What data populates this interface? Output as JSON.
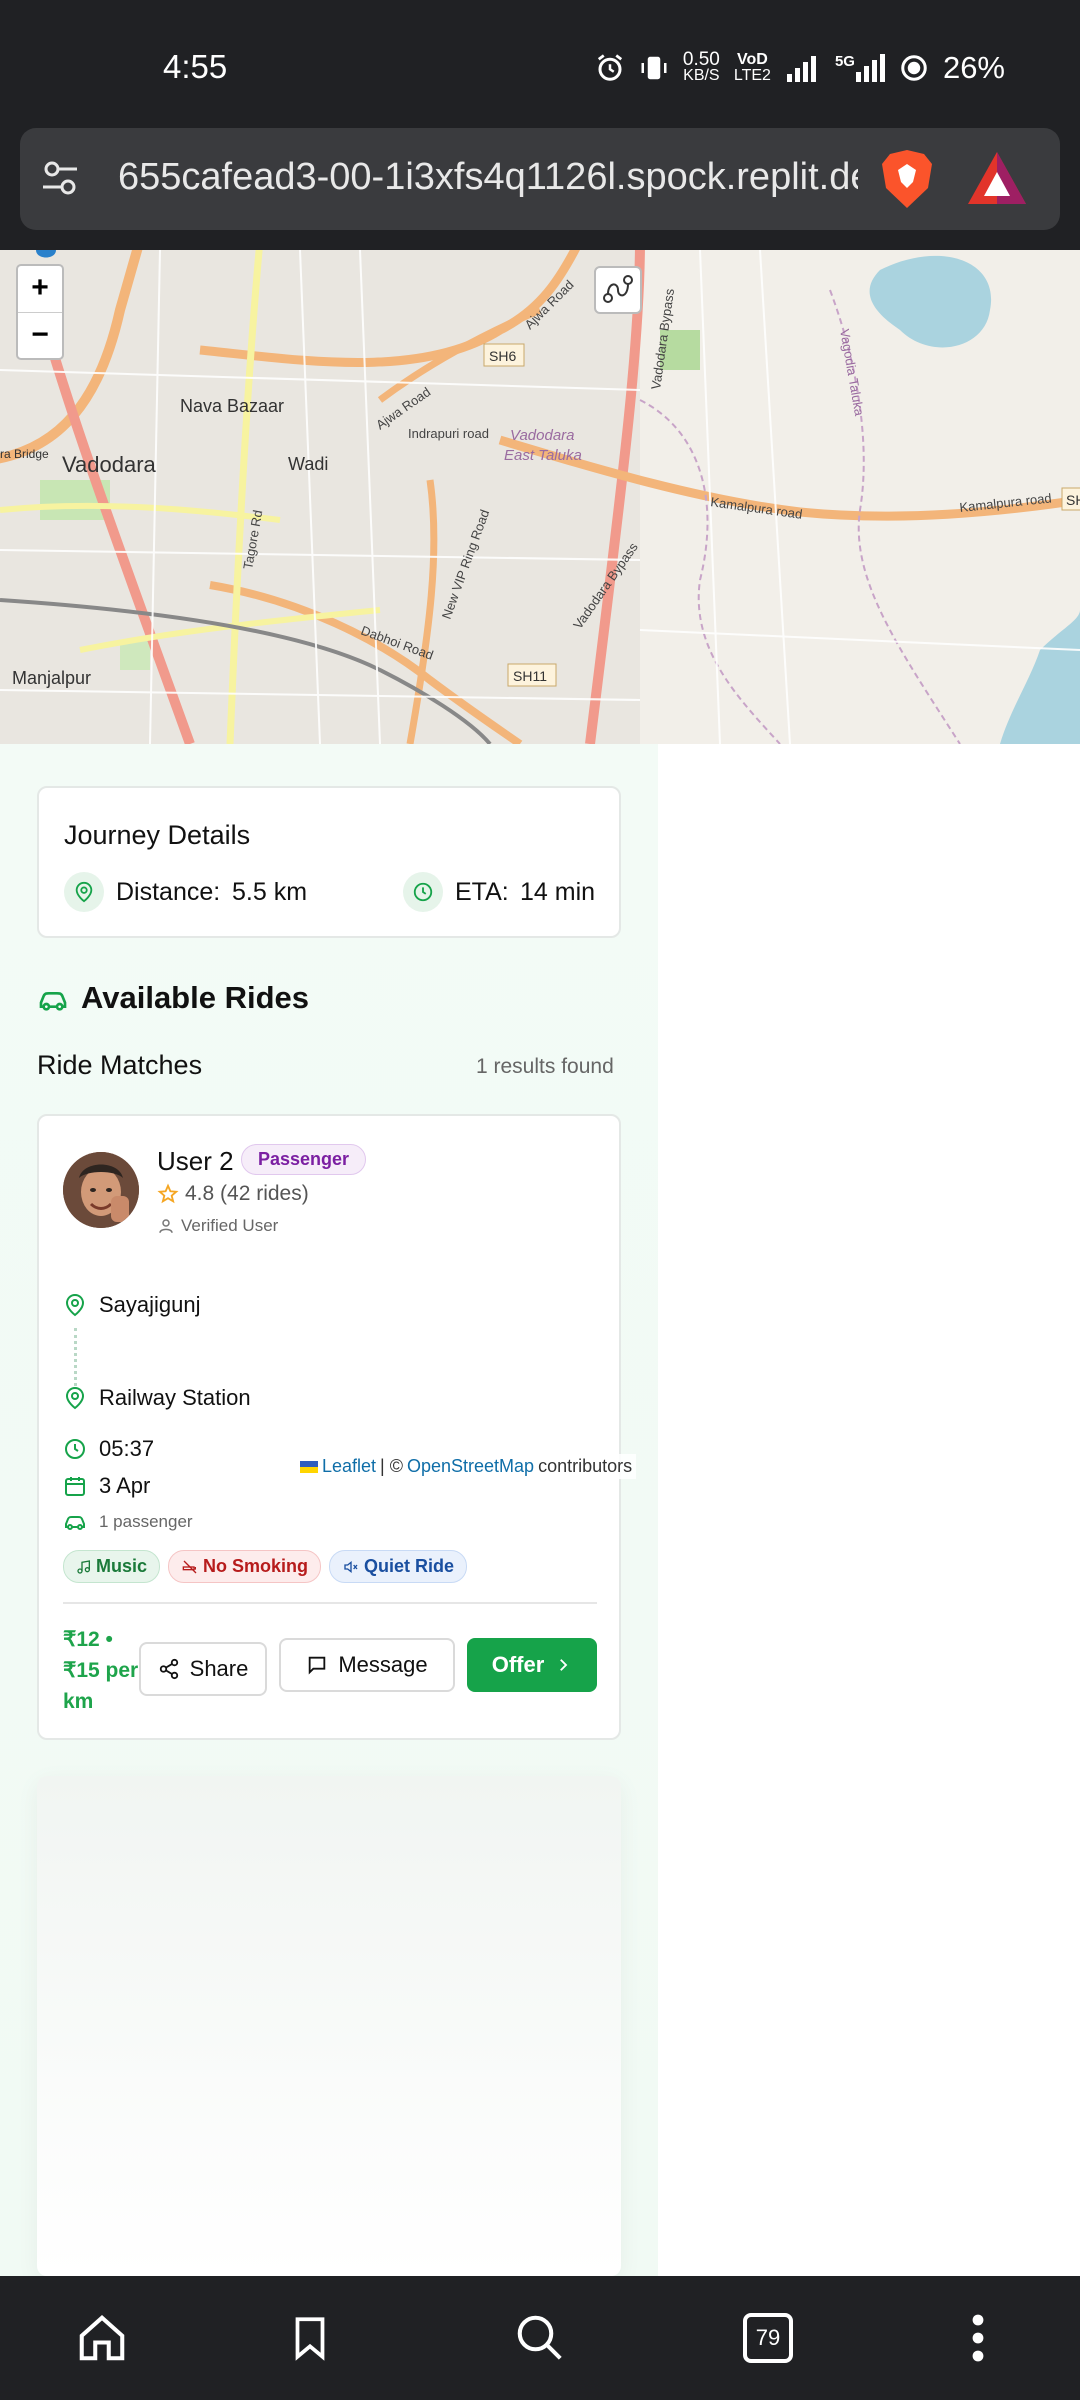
{
  "status_bar": {
    "time": "4:55",
    "speed_value": "0.50",
    "speed_unit": "KB/S",
    "volte_top": "VoD",
    "volte_bottom": "LTE2",
    "network": "5G",
    "battery": "26%"
  },
  "browser": {
    "url": "655cafead3-00-1i3xfs4q1126l.spock.replit.dev",
    "tab_count": "79"
  },
  "map": {
    "zoom_in": "+",
    "zoom_out": "−",
    "labels": {
      "sh6": "SH6",
      "sh11": "SH11",
      "nava_bazaar": "Nava Bazaar",
      "vadodara": "Vadodara",
      "wadi": "Wadi",
      "manjalpur": "Manjalpur",
      "indrapuri": "Indrapuri road",
      "vadodara_east": "Vadodara",
      "east_taluka": "East Taluka",
      "kamalpura": "Kamalpura road",
      "kamalpura2": "Kamalpura road",
      "ajwa": "Ajwa Road",
      "ajwa2": "Ajwa Road",
      "tagore": "Tagore Rd",
      "vip": "New VIP Ring Road",
      "dabhoi": "Dabhoi Road",
      "bypass": "Vadodara Bypass",
      "bypass2": "Vadodara Bypass",
      "vagodia": "Vagodia Taluka",
      "bridge": "ra Bridge",
      "sh_right": "SH"
    },
    "attribution": {
      "leaflet": "Leaflet",
      "sep": "| ©",
      "osm": "OpenStreetMap",
      "contributors": "contributors"
    }
  },
  "journey": {
    "title": "Journey Details",
    "distance_label": "Distance:",
    "distance_value": "5.5 km",
    "eta_label": "ETA:",
    "eta_value": "14 min"
  },
  "available_rides": {
    "heading": "Available Rides",
    "matches_title": "Ride Matches",
    "results": "1 results found"
  },
  "ride": {
    "user_name": "User 2",
    "role_badge": "Passenger",
    "rating": "4.8 (42 rides)",
    "verified": "Verified User",
    "from": "Sayajigunj",
    "to": "Railway Station",
    "time": "05:37",
    "date": "3 Apr",
    "passengers": "1 passenger",
    "tags": [
      "Music",
      "No Smoking",
      "Quiet Ride"
    ],
    "price": "₹12 • ₹15 per km",
    "share_label": "Share",
    "message_label": "Message",
    "offer_label": "Offer"
  },
  "colors": {
    "accent_green": "#16a34a",
    "tag_music": "#1b7a3a",
    "tag_no_smoking": "#b71c1c",
    "tag_quiet": "#1a4fa0",
    "badge_purple": "#7b1fa2"
  }
}
